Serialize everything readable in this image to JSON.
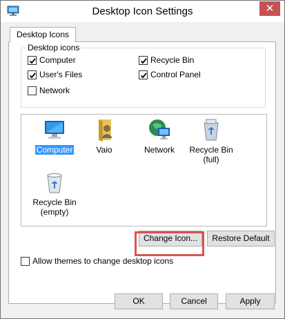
{
  "window": {
    "title": "Desktop Icon Settings",
    "close_glyph": "✕"
  },
  "tabs": [
    {
      "label": "Desktop Icons"
    }
  ],
  "desktop_icons_group": {
    "legend": "Desktop icons",
    "checkboxes": [
      {
        "label": "Computer",
        "checked": true
      },
      {
        "label": "Recycle Bin",
        "checked": true
      },
      {
        "label": "User's Files",
        "checked": true
      },
      {
        "label": "Control Panel",
        "checked": true
      },
      {
        "label": "Network",
        "checked": false
      }
    ]
  },
  "icon_list": [
    {
      "label": "Computer",
      "selected": true,
      "icon": "computer-icon"
    },
    {
      "label": "Vaio",
      "selected": false,
      "icon": "user-folder-icon"
    },
    {
      "label": "Network",
      "selected": false,
      "icon": "network-icon"
    },
    {
      "label": "Recycle Bin\n(full)",
      "selected": false,
      "icon": "recycle-bin-full-icon"
    },
    {
      "label": "Recycle Bin\n(empty)",
      "selected": false,
      "icon": "recycle-bin-empty-icon"
    }
  ],
  "buttons": {
    "change_icon": "Change Icon...",
    "restore_default": "Restore Default",
    "ok": "OK",
    "cancel": "Cancel",
    "apply": "Apply"
  },
  "allow_themes": {
    "label": "Allow themes to change desktop icons",
    "checked": false
  },
  "colors": {
    "selection": "#3399ff",
    "close_button": "#c75050",
    "highlight_box": "#d9534f"
  }
}
